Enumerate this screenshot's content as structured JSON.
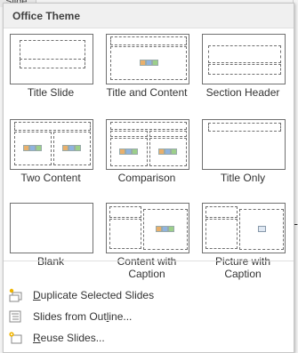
{
  "background": {
    "tab_label": "Slide"
  },
  "menu": {
    "header": "Office Theme",
    "layouts": [
      {
        "label": "Title Slide"
      },
      {
        "label": "Title and Content"
      },
      {
        "label": "Section Header"
      },
      {
        "label": "Two Content"
      },
      {
        "label": "Comparison"
      },
      {
        "label": "Title Only"
      },
      {
        "label": "Blank"
      },
      {
        "label_line1": "Content with",
        "label_line2": "Caption"
      },
      {
        "label_line1": "Picture with",
        "label_line2": "Caption"
      }
    ],
    "actions": [
      {
        "label_first": "D",
        "label_rest": "uplicate Selected Slides",
        "icon": "duplicate-slides-icon"
      },
      {
        "label_start": "Slides from Out",
        "label_u": "l",
        "label_end": "ine...",
        "icon": "slides-from-outline-icon"
      },
      {
        "label_first": "R",
        "label_rest": "euse Slides...",
        "icon": "reuse-slides-icon"
      }
    ]
  },
  "colors": {
    "accent_orange": "#e07a2c",
    "accent_blue": "#2f6fbf",
    "accent_green": "#6aa84f"
  }
}
